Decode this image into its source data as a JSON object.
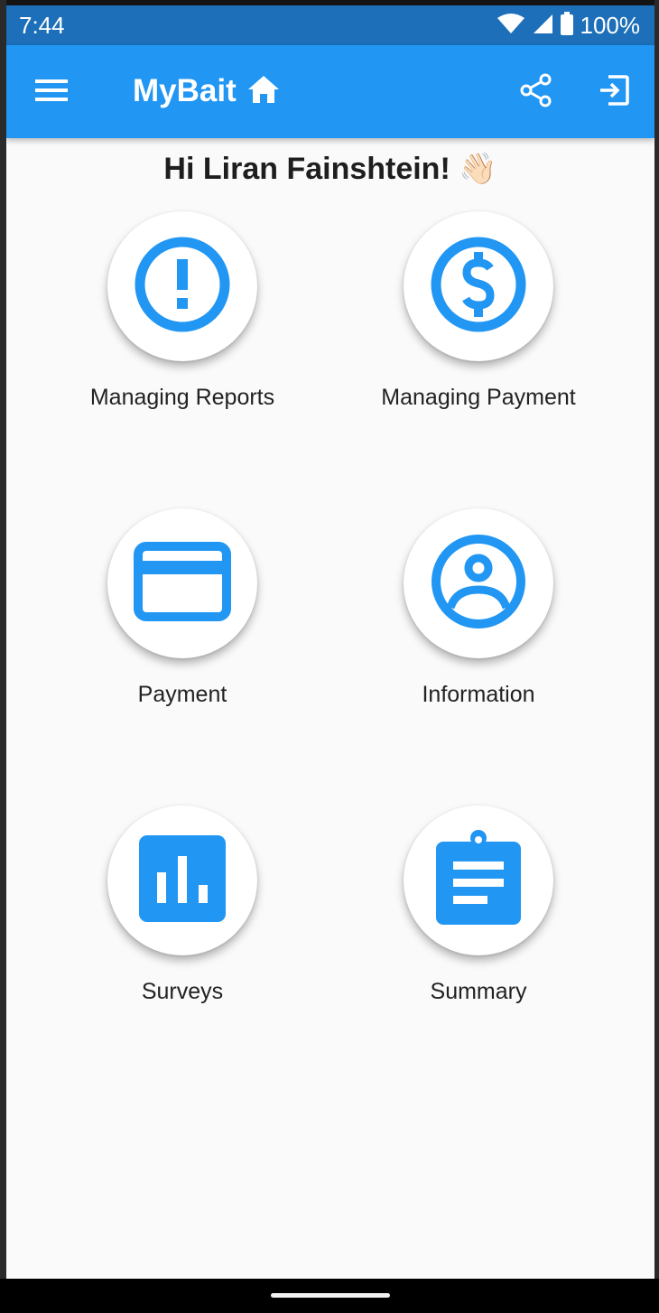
{
  "status_bar": {
    "time": "7:44",
    "battery": "100%",
    "icons": [
      "wifi-icon",
      "signal-icon",
      "battery-icon"
    ]
  },
  "app_bar": {
    "title": "MyBait",
    "title_icon": "home-icon",
    "menu_icon": "menu-icon",
    "share_icon": "share-icon",
    "logout_icon": "logout-icon",
    "color": "#2196f3"
  },
  "greeting": {
    "text": "Hi Liran Fainshtein! 👋🏻"
  },
  "tiles": [
    {
      "label": "Managing Reports",
      "icon": "alert-circle-icon"
    },
    {
      "label": "Managing Payment",
      "icon": "dollar-circle-icon"
    },
    {
      "label": "Payment",
      "icon": "credit-card-icon"
    },
    {
      "label": "Information",
      "icon": "account-circle-icon"
    },
    {
      "label": "Surveys",
      "icon": "bar-chart-icon"
    },
    {
      "label": "Summary",
      "icon": "clipboard-icon"
    }
  ],
  "accent_color": "#2196f3",
  "status_bar_color": "#1c6fb8"
}
